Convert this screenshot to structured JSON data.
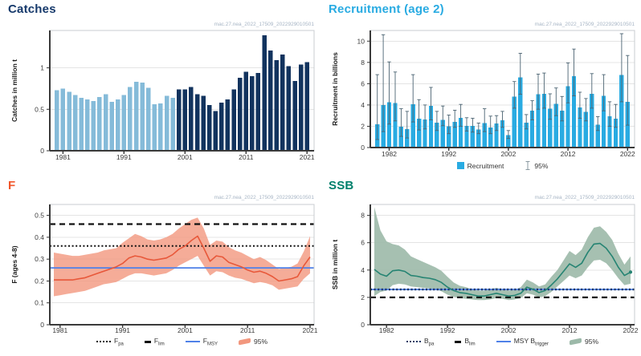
{
  "watermark": "mac.27.nea_2022_17509_2022929010501",
  "colors": {
    "catch_bar_early": "#85bbd9",
    "catch_bar_late": "#12335e",
    "recruit_bar": "#29abe2",
    "error_bar": "#4c6472",
    "f_line": "#e8583a",
    "f_band": "#f2977e",
    "msy_line": "#4f81e8",
    "ssb_line": "#268473",
    "ssb_band": "#9cb9a9",
    "ref_dark": "#111111",
    "bpa_navy": "#1f3864",
    "grid": "#e4e4e4",
    "axis_dark": "#3a3a3a",
    "box_border": "#c9cdd1"
  },
  "panels": {
    "catches": {
      "title": "Catches",
      "title_color": "#16396b",
      "ylabel": "Catches in million t"
    },
    "recruitment": {
      "title": "Recruitment (age 2)",
      "title_color": "#29abe2",
      "ylabel": "Recruitment in billions",
      "legend": [
        {
          "swatch": "square",
          "label": "Recruitment"
        },
        {
          "swatch": "errorbar",
          "label": "95%"
        }
      ]
    },
    "f": {
      "title": "F",
      "title_color": "#f1562a",
      "ylabel": "F (ages 4-8)",
      "legend": [
        {
          "swatch": "dotted",
          "label": "F",
          "sub": "pa"
        },
        {
          "swatch": "dash",
          "label": "F",
          "sub": "lim"
        },
        {
          "swatch": "line",
          "label": "F",
          "sub": "MSY"
        },
        {
          "swatch": "ribbon-salmon",
          "label": "95%"
        }
      ]
    },
    "ssb": {
      "title": "SSB",
      "title_color": "#00806c",
      "ylabel": "SSB in million t",
      "legend": [
        {
          "swatch": "dotted-navy",
          "label": "B",
          "sub": "pa"
        },
        {
          "swatch": "dash",
          "label": "B",
          "sub": "lim"
        },
        {
          "swatch": "line",
          "label": "MSY B",
          "sub": "trigger"
        },
        {
          "swatch": "ribbon-green",
          "label": "95%"
        }
      ]
    }
  },
  "chart_data": [
    {
      "name": "catches",
      "type": "bar",
      "title": "Catches",
      "ylabel": "Catches in million t",
      "years": {
        "start": 1980,
        "end": 2021
      },
      "values": [
        0.73,
        0.75,
        0.71,
        0.67,
        0.64,
        0.62,
        0.6,
        0.65,
        0.68,
        0.59,
        0.62,
        0.67,
        0.77,
        0.83,
        0.82,
        0.76,
        0.56,
        0.57,
        0.66,
        0.64,
        0.74,
        0.74,
        0.77,
        0.68,
        0.66,
        0.55,
        0.48,
        0.58,
        0.62,
        0.74,
        0.88,
        0.95,
        0.9,
        0.94,
        1.39,
        1.21,
        1.09,
        1.16,
        1.02,
        0.84,
        1.04,
        1.07
      ],
      "split_year": 2000,
      "bar_color_early": "catch_bar_early",
      "bar_color_late": "catch_bar_late",
      "xticks": [
        1981,
        1991,
        2001,
        2011,
        2021
      ],
      "yticks": [
        0,
        0.5,
        1
      ],
      "ylim": [
        0,
        1.45
      ]
    },
    {
      "name": "recruitment",
      "type": "bar",
      "title": "Recruitment (age 2)",
      "ylabel": "Recruitment in billions",
      "years": {
        "start": 1980,
        "end": 2022
      },
      "values": [
        2.2,
        4.0,
        4.25,
        4.2,
        1.95,
        1.75,
        4.05,
        2.7,
        2.65,
        3.9,
        2.35,
        2.6,
        2.0,
        2.4,
        2.8,
        2.05,
        2.05,
        1.7,
        2.3,
        1.9,
        2.25,
        2.55,
        1.15,
        4.8,
        6.6,
        2.35,
        3.45,
        5.0,
        5.05,
        3.65,
        4.1,
        3.45,
        5.75,
        6.7,
        3.75,
        3.35,
        5.05,
        2.15,
        4.85,
        2.95,
        2.7,
        6.8,
        4.3
      ],
      "ci_low": [
        0.75,
        1.5,
        2.2,
        2.5,
        1.05,
        0.9,
        2.4,
        1.65,
        1.75,
        2.6,
        1.6,
        2.05,
        1.3,
        1.9,
        2.0,
        1.55,
        1.45,
        1.3,
        1.5,
        1.3,
        1.6,
        1.9,
        0.85,
        3.7,
        5.0,
        1.75,
        2.6,
        3.6,
        3.7,
        2.65,
        3.0,
        2.5,
        4.2,
        4.85,
        2.75,
        2.5,
        3.7,
        1.6,
        3.45,
        2.0,
        1.9,
        4.3,
        2.1
      ],
      "ci_high": [
        6.85,
        10.6,
        8.05,
        7.1,
        3.65,
        3.4,
        6.85,
        4.5,
        4.0,
        5.65,
        3.4,
        3.9,
        3.05,
        3.5,
        4.05,
        2.8,
        2.75,
        2.3,
        3.65,
        2.95,
        3.0,
        3.4,
        1.6,
        6.2,
        8.85,
        3.1,
        4.4,
        6.9,
        7.0,
        5.05,
        5.6,
        4.8,
        7.95,
        9.25,
        5.2,
        4.6,
        6.95,
        2.9,
        6.85,
        4.3,
        4.05,
        10.7,
        8.65
      ],
      "bar_color": "recruit_bar",
      "xticks": [
        1982,
        1992,
        2002,
        2012,
        2022
      ],
      "yticks": [
        0,
        2,
        4,
        6,
        8,
        10
      ],
      "ylim": [
        0,
        11
      ]
    },
    {
      "name": "f",
      "type": "line",
      "title": "F",
      "ylabel": "F (ages 4-8)",
      "years": {
        "start": 1980,
        "end": 2021
      },
      "values": [
        0.205,
        0.205,
        0.205,
        0.205,
        0.21,
        0.215,
        0.225,
        0.235,
        0.245,
        0.255,
        0.265,
        0.28,
        0.305,
        0.315,
        0.31,
        0.3,
        0.295,
        0.3,
        0.305,
        0.32,
        0.345,
        0.36,
        0.385,
        0.405,
        0.35,
        0.29,
        0.315,
        0.31,
        0.285,
        0.275,
        0.265,
        0.25,
        0.24,
        0.245,
        0.235,
        0.22,
        0.2,
        0.205,
        0.21,
        0.22,
        0.27,
        0.31
      ],
      "band_low": [
        0.13,
        0.135,
        0.14,
        0.145,
        0.15,
        0.155,
        0.165,
        0.175,
        0.185,
        0.19,
        0.195,
        0.21,
        0.225,
        0.235,
        0.235,
        0.23,
        0.225,
        0.23,
        0.235,
        0.25,
        0.27,
        0.285,
        0.3,
        0.315,
        0.27,
        0.225,
        0.245,
        0.24,
        0.225,
        0.215,
        0.21,
        0.2,
        0.19,
        0.195,
        0.19,
        0.18,
        0.16,
        0.165,
        0.17,
        0.175,
        0.21,
        0.235
      ],
      "band_high": [
        0.33,
        0.325,
        0.32,
        0.315,
        0.315,
        0.32,
        0.325,
        0.33,
        0.34,
        0.345,
        0.35,
        0.375,
        0.395,
        0.415,
        0.405,
        0.39,
        0.385,
        0.39,
        0.4,
        0.415,
        0.44,
        0.46,
        0.48,
        0.49,
        0.44,
        0.365,
        0.385,
        0.38,
        0.355,
        0.34,
        0.33,
        0.315,
        0.3,
        0.31,
        0.295,
        0.275,
        0.255,
        0.26,
        0.265,
        0.28,
        0.335,
        0.405
      ],
      "line_color": "f_line",
      "band_color": "f_band",
      "band_opacity": 0.8,
      "ref_lines": [
        {
          "label": "Flim",
          "value": 0.46,
          "style": "dashed",
          "color": "#111111",
          "width": 2.2
        },
        {
          "label": "Fpa",
          "value": 0.36,
          "style": "dotted",
          "color": "#111111",
          "width": 2
        },
        {
          "label": "FMSY",
          "value": 0.26,
          "style": "solid",
          "color": "#4f81e8",
          "width": 1.7
        }
      ],
      "xticks": [
        1981,
        1991,
        2001,
        2011,
        2021
      ],
      "yticks": [
        0,
        0.1,
        0.2,
        0.3,
        0.4,
        0.5
      ],
      "ylim": [
        0,
        0.55
      ]
    },
    {
      "name": "ssb",
      "type": "line",
      "title": "SSB",
      "ylabel": "SSB in million t",
      "years": {
        "start": 1980,
        "end": 2022
      },
      "values": [
        4.05,
        3.7,
        3.55,
        3.95,
        4.0,
        3.9,
        3.6,
        3.55,
        3.45,
        3.4,
        3.3,
        3.1,
        2.75,
        2.5,
        2.35,
        2.3,
        2.2,
        2.1,
        2.1,
        2.2,
        2.3,
        2.2,
        2.1,
        2.15,
        2.3,
        2.75,
        2.6,
        2.35,
        2.5,
        2.9,
        3.35,
        3.9,
        4.45,
        4.2,
        4.5,
        5.3,
        5.9,
        5.95,
        5.6,
        5.0,
        4.2,
        3.6,
        3.85
      ],
      "band_low": [
        2.1,
        2.4,
        2.5,
        2.9,
        3.0,
        2.95,
        2.8,
        2.75,
        2.7,
        2.65,
        2.6,
        2.45,
        2.2,
        2.05,
        1.95,
        1.9,
        1.85,
        1.8,
        1.8,
        1.85,
        1.95,
        1.9,
        1.8,
        1.85,
        1.95,
        2.3,
        2.2,
        2.0,
        2.1,
        2.4,
        2.8,
        3.2,
        3.6,
        3.4,
        3.6,
        4.2,
        4.7,
        4.75,
        4.5,
        4.0,
        3.4,
        2.9,
        3.0
      ],
      "band_high": [
        8.6,
        6.9,
        6.1,
        5.9,
        5.8,
        5.5,
        5.0,
        4.8,
        4.6,
        4.4,
        4.2,
        3.95,
        3.5,
        3.1,
        2.85,
        2.75,
        2.6,
        2.5,
        2.5,
        2.6,
        2.7,
        2.6,
        2.5,
        2.55,
        2.75,
        3.3,
        3.1,
        2.8,
        2.95,
        3.5,
        4.0,
        4.7,
        5.4,
        5.1,
        5.5,
        6.4,
        7.1,
        7.2,
        6.8,
        6.2,
        5.2,
        4.4,
        5.0
      ],
      "line_color": "ssb_line",
      "band_color": "ssb_band",
      "band_opacity": 0.9,
      "end_marker": true,
      "ref_lines": [
        {
          "label": "MSY Btrigger",
          "value": 2.58,
          "style": "solid",
          "color": "#4f81e8",
          "width": 1.7
        },
        {
          "label": "Bpa",
          "value": 2.58,
          "style": "dotted",
          "color": "#1f3864",
          "width": 2.4
        },
        {
          "label": "Blim",
          "value": 2.0,
          "style": "dashed",
          "color": "#111111",
          "width": 2.2
        }
      ],
      "xticks": [
        1982,
        1992,
        2002,
        2012,
        2022
      ],
      "yticks": [
        0,
        2,
        4,
        6,
        8
      ],
      "ylim": [
        0,
        8.8
      ]
    }
  ]
}
